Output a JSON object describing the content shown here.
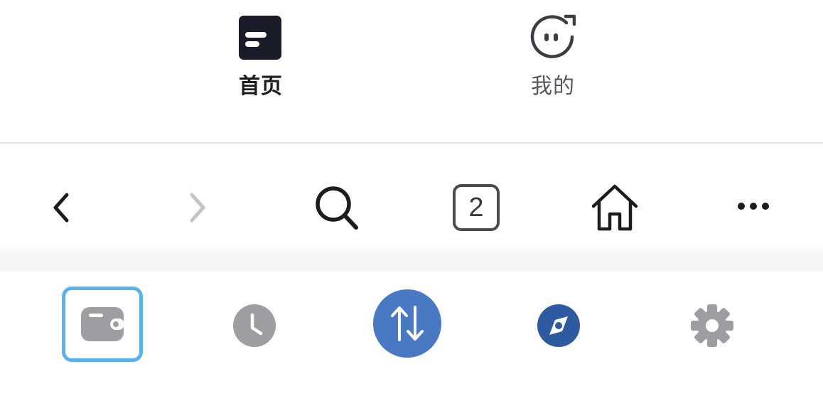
{
  "app_tabbar": {
    "tabs": [
      {
        "label": "首页",
        "icon": "home-tab-icon",
        "active": true
      },
      {
        "label": "我的",
        "icon": "profile-face-icon",
        "active": false
      }
    ]
  },
  "browser_toolbar": {
    "tab_count": "2",
    "buttons": [
      "back-arrow-icon",
      "forward-arrow-icon",
      "search-icon",
      "tab-count-button",
      "home-icon",
      "more-icon"
    ]
  },
  "wallet_nav": {
    "items": [
      "wallet-icon",
      "clock-icon",
      "swap-arrows-icon",
      "compass-icon",
      "gear-icon"
    ],
    "selected": "wallet-icon"
  },
  "colors": {
    "active_text": "#1c1c22",
    "inactive_text": "#55575c",
    "selected_outline": "#56b2f0",
    "swap_blue": "#4a79c4",
    "discover_blue": "#2e5b9f",
    "inactive_icon": "#9c9ea2"
  }
}
